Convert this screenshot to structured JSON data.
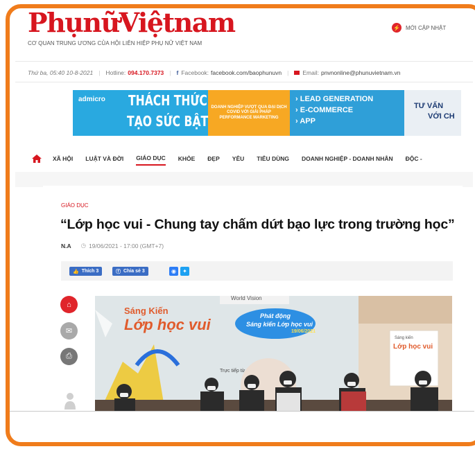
{
  "header": {
    "logo": "PhụnữViệtnam",
    "tagline": "CƠ QUAN TRUNG ƯƠNG CỦA HỘI LIÊN HIỆP PHỤ NỮ VIỆT NAM",
    "new_update_label": "MỚI CẬP NHẬT"
  },
  "infobar": {
    "date": "Thứ ba, 05:40 10-8-2021",
    "hotline_label": "Hotline:",
    "hotline_value": "094.170.7373",
    "facebook_label": "Facebook:",
    "facebook_value": "facebook.com/baophunuvn",
    "email_label": "Email:",
    "email_value": "pnvnonline@phunuvietnam.vn"
  },
  "banner": {
    "brand": "admicro",
    "headline_1": "THÁCH THỨC",
    "headline_2": "TẠO SỨC BẬT",
    "middle_text": "DOANH NGHIỆP VƯỢT QUA ĐẠI DỊCH COVID VỚI GIẢI PHÁP PERFORMANCE MARKETING",
    "items": [
      "LEAD GENERATION",
      "E-COMMERCE",
      "APP"
    ],
    "far_1": "TƯ VẤN",
    "far_2": "VỚI CH"
  },
  "nav": {
    "items": [
      "XÃ HỘI",
      "LUẬT VÀ ĐỜI",
      "GIÁO DỤC",
      "KHỎE",
      "ĐẸP",
      "YÊU",
      "TIÊU DÙNG",
      "DOANH NGHIỆP - DOANH NHÂN",
      "ĐỘC -"
    ],
    "active_index": 2
  },
  "article": {
    "category": "GIÁO DỤC",
    "title": "“Lớp học vui - Chung tay chấm dứt bạo lực trong trường học”",
    "author": "N.A",
    "time": "19/06/2021 - 17:00 (GMT+7)",
    "like_label": "Thích 3",
    "share_label": "Chia sẻ 3"
  },
  "photo": {
    "org_text": "World Vision",
    "title_small": "Sáng Kiến",
    "title_big": "Lớp học vui",
    "bubble_1": "Phát động",
    "bubble_2": "Sáng kiến Lớp học vui",
    "bubble_date": "19/06/2021",
    "sign_small": "Sáng kiến",
    "sign_big": "Lớp học vui",
    "caption": "Trực tiếp từ"
  },
  "colors": {
    "frame": "#f07c1b",
    "brand_red": "#d7161f",
    "facebook_blue": "#3b6dc4",
    "banner_blue": "#29a9e0",
    "banner_orange": "#f7a823"
  },
  "icons": {
    "home": "home-icon",
    "update": "bolt-icon",
    "clock": "clock-icon",
    "side": [
      "home-icon",
      "mail-icon",
      "print-icon",
      "person-icon"
    ]
  }
}
